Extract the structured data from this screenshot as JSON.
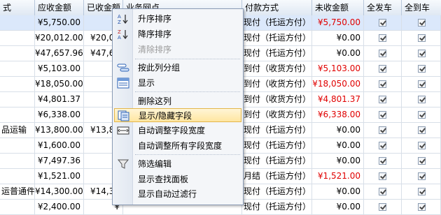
{
  "columns": [
    "式",
    "应收金额",
    "已收金额",
    "业务网点",
    "付款方式",
    "未收金额",
    "全发车",
    "全到车"
  ],
  "rows": [
    {
      "c0": "",
      "due": "¥5,750.00",
      "recv": "¥",
      "pay": "现付（托运方付）",
      "unpaid": "¥5,750.00",
      "unpaid_red": true,
      "sent": true,
      "arrived": true,
      "selected": true
    },
    {
      "c0": "",
      "due": "¥20,012.00",
      "recv": "¥20,01",
      "pay": "现付（托运方付）",
      "unpaid": "¥0.00",
      "unpaid_red": false,
      "sent": true,
      "arrived": true,
      "selected": false
    },
    {
      "c0": "",
      "due": "¥47,657.96",
      "recv": "¥47,65",
      "pay": "现付（托运方付）",
      "unpaid": "¥0.00",
      "unpaid_red": false,
      "sent": true,
      "arrived": true,
      "selected": false
    },
    {
      "c0": "",
      "due": "¥5,103.00",
      "recv": "",
      "pay": "到付（收货方付）",
      "unpaid": "¥5,103.00",
      "unpaid_red": true,
      "sent": true,
      "arrived": true,
      "selected": false
    },
    {
      "c0": "",
      "due": "¥18,050.00",
      "recv": "",
      "pay": "到付（收货方付）",
      "unpaid": "¥18,050.00",
      "unpaid_red": true,
      "sent": true,
      "arrived": true,
      "selected": false
    },
    {
      "c0": "",
      "due": "¥4,801.37",
      "recv": "",
      "pay": "到付（收货方付）",
      "unpaid": "¥4,801.37",
      "unpaid_red": true,
      "sent": true,
      "arrived": true,
      "selected": false
    },
    {
      "c0": "",
      "due": "¥6,338.00",
      "recv": "",
      "pay": "到付（收货方付）",
      "unpaid": "¥6,338.00",
      "unpaid_red": true,
      "sent": true,
      "arrived": true,
      "selected": false
    },
    {
      "c0": "品运输",
      "due": "¥13,800.00",
      "recv": "¥13,80",
      "pay": "现付（托运方付）",
      "unpaid": "¥0.00",
      "unpaid_red": false,
      "sent": true,
      "arrived": true,
      "selected": false
    },
    {
      "c0": "",
      "due": "¥1,600.00",
      "recv": "¥",
      "pay": "现付（托运方付）",
      "unpaid": "¥0.00",
      "unpaid_red": false,
      "sent": true,
      "arrived": true,
      "selected": false
    },
    {
      "c0": "",
      "due": "¥7,497.36",
      "recv": "¥",
      "pay": "现付（托运方付）",
      "unpaid": "¥0.00",
      "unpaid_red": false,
      "sent": true,
      "arrived": true,
      "selected": false
    },
    {
      "c0": "",
      "due": "¥1,521.00",
      "recv": "",
      "pay": "月结（托运方付）",
      "unpaid": "¥1,521.00",
      "unpaid_red": true,
      "sent": true,
      "arrived": true,
      "selected": false
    },
    {
      "c0": "运普通件",
      "due": "¥14,300.00",
      "recv": "¥14,30",
      "pay": "现付（托运方付）",
      "unpaid": "¥0.00",
      "unpaid_red": false,
      "sent": true,
      "arrived": true,
      "selected": false
    },
    {
      "c0": "",
      "due": "¥2,400.00",
      "recv": "¥",
      "pay": "现付（托运方付）",
      "unpaid": "¥0.00",
      "unpaid_red": false,
      "sent": true,
      "arrived": true,
      "selected": false
    }
  ],
  "menu": [
    {
      "label": "升序排序",
      "icon": "sort-ascending-icon",
      "disabled": false
    },
    {
      "label": "降序排序",
      "icon": "sort-descending-icon",
      "disabled": false
    },
    {
      "label": "清除排序",
      "icon": "",
      "disabled": true
    },
    {
      "label": "按此列分组",
      "icon": "group-by-column-icon",
      "disabled": false
    },
    {
      "label": "显示",
      "icon": "group-panel-icon",
      "disabled": false
    },
    {
      "label": "删除这列",
      "icon": "",
      "disabled": false
    },
    {
      "label": "显示/隐藏字段",
      "icon": "column-chooser-icon",
      "disabled": false
    },
    {
      "label": "自动调整字段宽度",
      "icon": "best-fit-icon",
      "disabled": false
    },
    {
      "label": "自动调整所有字段宽度",
      "icon": "",
      "disabled": false
    },
    {
      "label": "筛选编辑",
      "icon": "filter-funnel-icon",
      "disabled": false
    },
    {
      "label": "显示查找面板",
      "icon": "",
      "disabled": false
    },
    {
      "label": "显示自动过滤行",
      "icon": "",
      "disabled": false
    }
  ]
}
